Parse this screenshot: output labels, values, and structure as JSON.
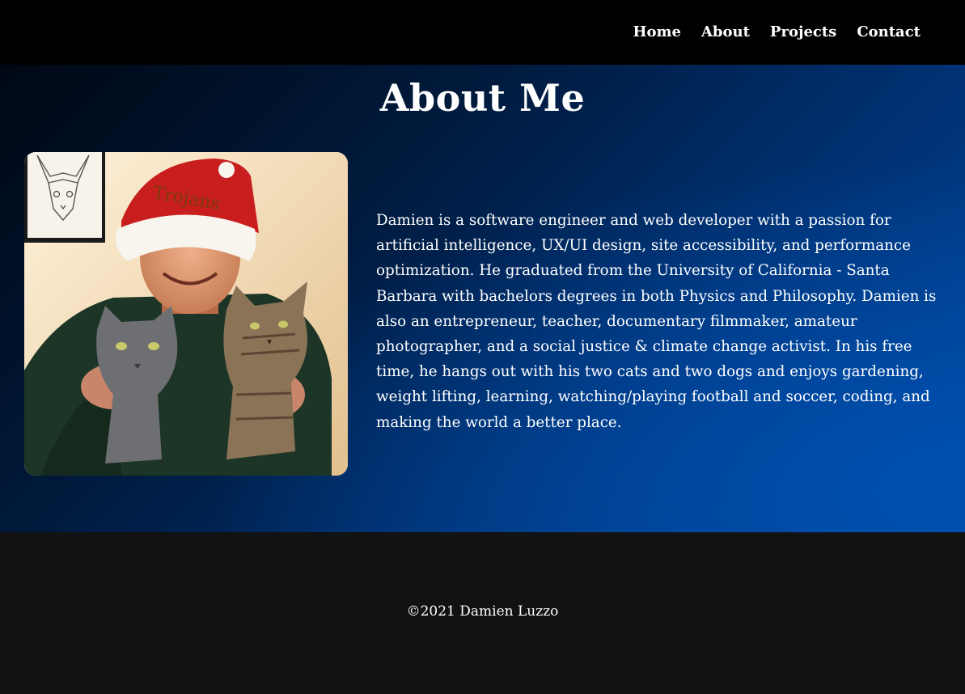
{
  "nav": {
    "items": [
      {
        "label": "Home"
      },
      {
        "label": "About"
      },
      {
        "label": "Projects"
      },
      {
        "label": "Contact"
      }
    ]
  },
  "about": {
    "title": "About Me",
    "bio": "Damien is a software engineer and web developer with a passion for artificial intelligence, UX/UI design, site accessibility, and performance optimization. He graduated from the University of California - Santa Barbara with bachelors degrees in both Physics and Philosophy. Damien is also an entrepreneur, teacher, documentary filmmaker, amateur photographer, and a social justice & climate change activist. In his free time, he hangs out with his two cats and two dogs and enjoys gardening, weight lifting, learning, watching/playing football and soccer, coding, and making the world a better place.",
    "photo": {
      "hat_text": "Trojans"
    }
  },
  "footer": {
    "copyright": "©2021 Damien Luzzo"
  },
  "colors": {
    "nav_bg": "#000000",
    "footer_bg": "#121212",
    "gradient_dark": "#000814",
    "gradient_light": "#0048a0",
    "text": "#ffffff"
  }
}
